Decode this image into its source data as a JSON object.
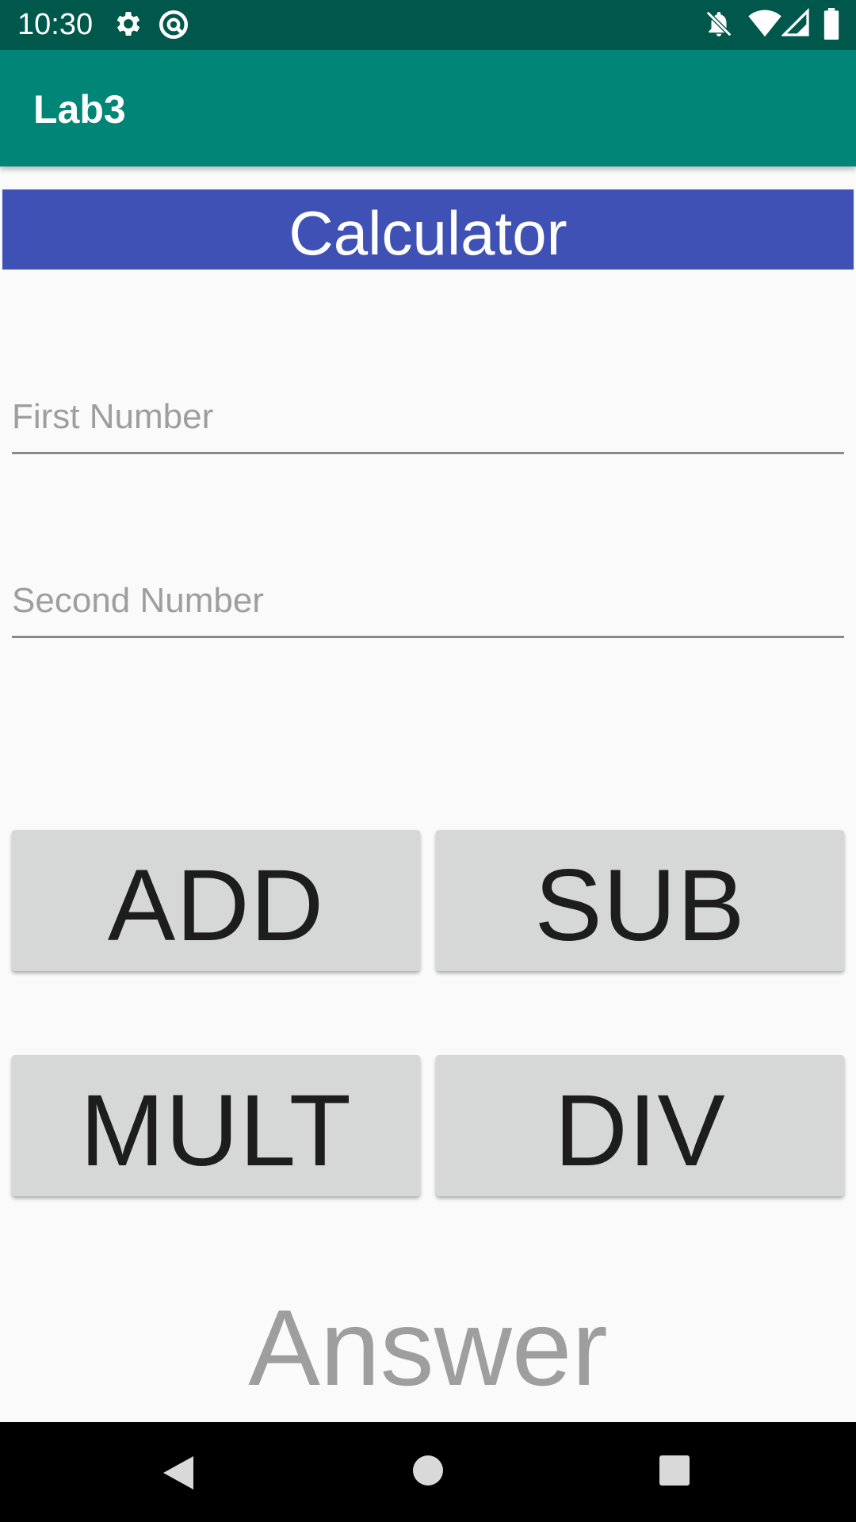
{
  "status_bar": {
    "time": "10:30",
    "icons": [
      "gear-icon",
      "at-sign-icon",
      "bell-off-icon",
      "wifi-icon",
      "signal-icon",
      "battery-icon"
    ]
  },
  "app_bar": {
    "title": "Lab3"
  },
  "header": {
    "text": "Calculator"
  },
  "inputs": {
    "first": {
      "value": "",
      "placeholder": "First Number"
    },
    "second": {
      "value": "",
      "placeholder": "Second Number"
    }
  },
  "buttons": {
    "add": "ADD",
    "sub": "SUB",
    "mult": "MULT",
    "div": "DIV"
  },
  "result": {
    "text": "Answer"
  },
  "nav_bar": {
    "icons": [
      "back-icon",
      "home-icon",
      "recents-icon"
    ]
  },
  "colors": {
    "status_bar": "#00574b",
    "app_bar": "#008577",
    "header": "#3f51b5",
    "button": "#d6d7d7"
  }
}
